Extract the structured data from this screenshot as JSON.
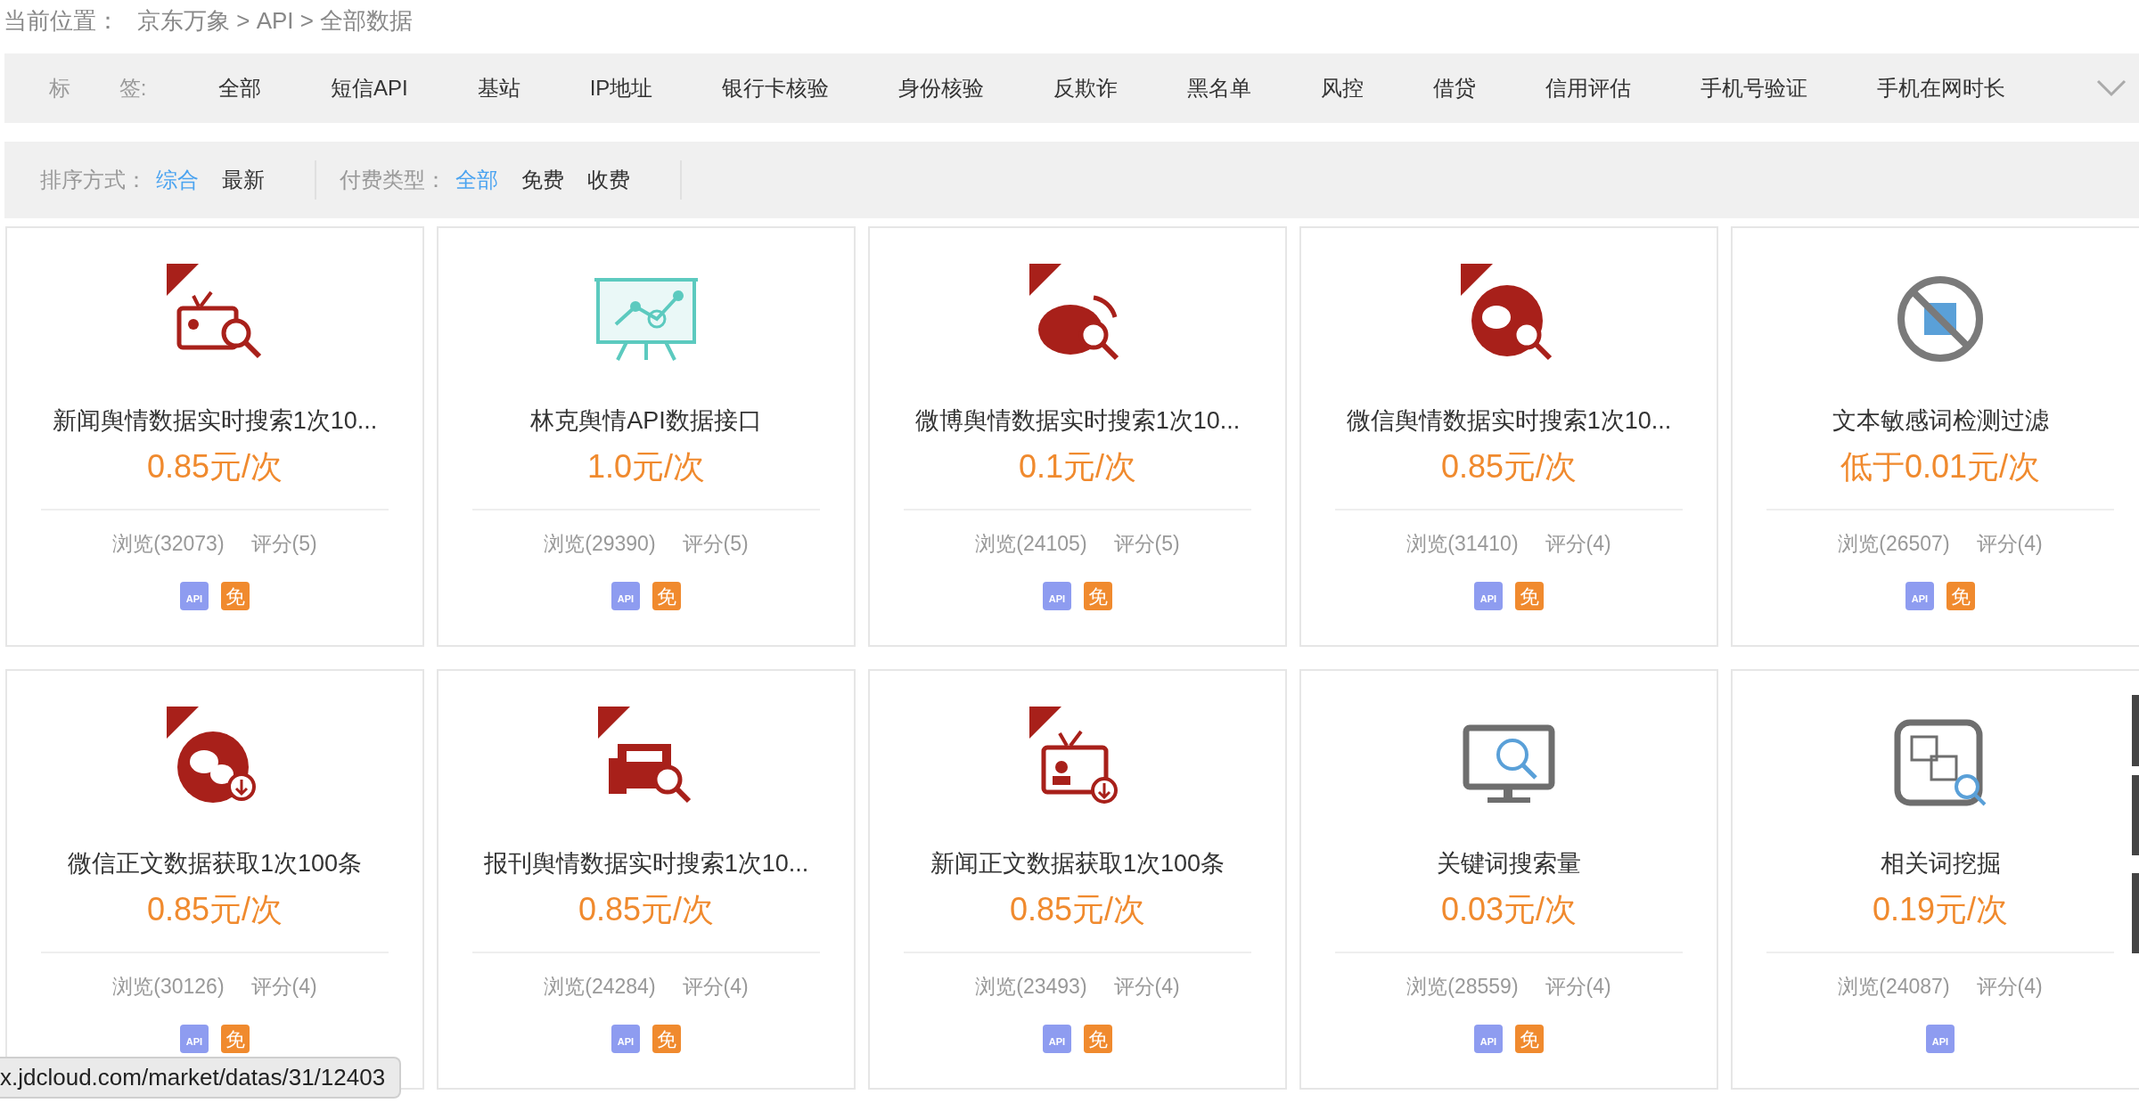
{
  "breadcrumb": {
    "label": "当前位置：",
    "path": "京东万象 > API > 全部数据"
  },
  "tag_bar": {
    "label": "标 签:",
    "tags": [
      {
        "label": "全部",
        "selected": false
      },
      {
        "label": "短信API",
        "selected": false
      },
      {
        "label": "基站",
        "selected": false
      },
      {
        "label": "IP地址",
        "selected": false
      },
      {
        "label": "银行卡核验",
        "selected": false
      },
      {
        "label": "身份核验",
        "selected": false
      },
      {
        "label": "反欺诈",
        "selected": false
      },
      {
        "label": "黑名单",
        "selected": false
      },
      {
        "label": "风控",
        "selected": false
      },
      {
        "label": "借贷",
        "selected": false
      },
      {
        "label": "信用评估",
        "selected": false
      },
      {
        "label": "手机号验证",
        "selected": false
      },
      {
        "label": "手机在网时长",
        "selected": false
      }
    ]
  },
  "filters": [
    {
      "label": "排序方式：",
      "options": [
        {
          "label": "综合",
          "selected": true
        },
        {
          "label": "最新",
          "selected": false
        }
      ]
    },
    {
      "label": "付费类型：",
      "options": [
        {
          "label": "全部",
          "selected": true
        },
        {
          "label": "免费",
          "selected": false
        },
        {
          "label": "收费",
          "selected": false
        }
      ]
    }
  ],
  "products": [
    {
      "title": "新闻舆情数据实时搜索1次10...",
      "price": "0.85元/次",
      "views": "浏览(32073)",
      "rating": "评分(5)",
      "badges": [
        {
          "text": "API",
          "color": "#8e9cf0"
        },
        {
          "text": "免",
          "color": "#f08a2e"
        }
      ]
    },
    {
      "title": "林克舆情API数据接口",
      "price": "1.0元/次",
      "views": "浏览(29390)",
      "rating": "评分(5)",
      "badges": [
        {
          "text": "API",
          "color": "#8e9cf0"
        },
        {
          "text": "免",
          "color": "#f08a2e"
        }
      ]
    },
    {
      "title": "微博舆情数据实时搜索1次10...",
      "price": "0.1元/次",
      "views": "浏览(24105)",
      "rating": "评分(5)",
      "badges": [
        {
          "text": "API",
          "color": "#8e9cf0"
        },
        {
          "text": "免",
          "color": "#f08a2e"
        }
      ]
    },
    {
      "title": "微信舆情数据实时搜索1次10...",
      "price": "0.85元/次",
      "views": "浏览(31410)",
      "rating": "评分(4)",
      "badges": [
        {
          "text": "API",
          "color": "#8e9cf0"
        },
        {
          "text": "免",
          "color": "#f08a2e"
        }
      ]
    },
    {
      "title": "文本敏感词检测过滤",
      "price": "低于0.01元/次",
      "views": "浏览(26507)",
      "rating": "评分(4)",
      "badges": [
        {
          "text": "API",
          "color": "#8e9cf0"
        },
        {
          "text": "免",
          "color": "#f08a2e"
        }
      ]
    },
    {
      "title": "微信正文数据获取1次100条",
      "price": "0.85元/次",
      "views": "浏览(30126)",
      "rating": "评分(4)",
      "badges": [
        {
          "text": "API",
          "color": "#8e9cf0"
        },
        {
          "text": "免",
          "color": "#f08a2e"
        }
      ]
    },
    {
      "title": "报刊舆情数据实时搜索1次10...",
      "price": "0.85元/次",
      "views": "浏览(24284)",
      "rating": "评分(4)",
      "badges": [
        {
          "text": "API",
          "color": "#8e9cf0"
        },
        {
          "text": "免",
          "color": "#f08a2e"
        }
      ]
    },
    {
      "title": "新闻正文数据获取1次100条",
      "price": "0.85元/次",
      "views": "浏览(23493)",
      "rating": "评分(4)",
      "badges": [
        {
          "text": "API",
          "color": "#8e9cf0"
        },
        {
          "text": "免",
          "color": "#f08a2e"
        }
      ]
    },
    {
      "title": "关键词搜索量",
      "price": "0.03元/次",
      "views": "浏览(28559)",
      "rating": "评分(4)",
      "badges": [
        {
          "text": "API",
          "color": "#8e9cf0"
        },
        {
          "text": "免",
          "color": "#f08a2e"
        }
      ]
    },
    {
      "title": "相关词挖掘",
      "price": "0.19元/次",
      "views": "浏览(24087)",
      "rating": "评分(4)",
      "badges": [
        {
          "text": "API",
          "color": "#8e9cf0"
        }
      ]
    }
  ],
  "status_bar": {
    "url": "x.jdcloud.com/market/datas/31/12403"
  }
}
